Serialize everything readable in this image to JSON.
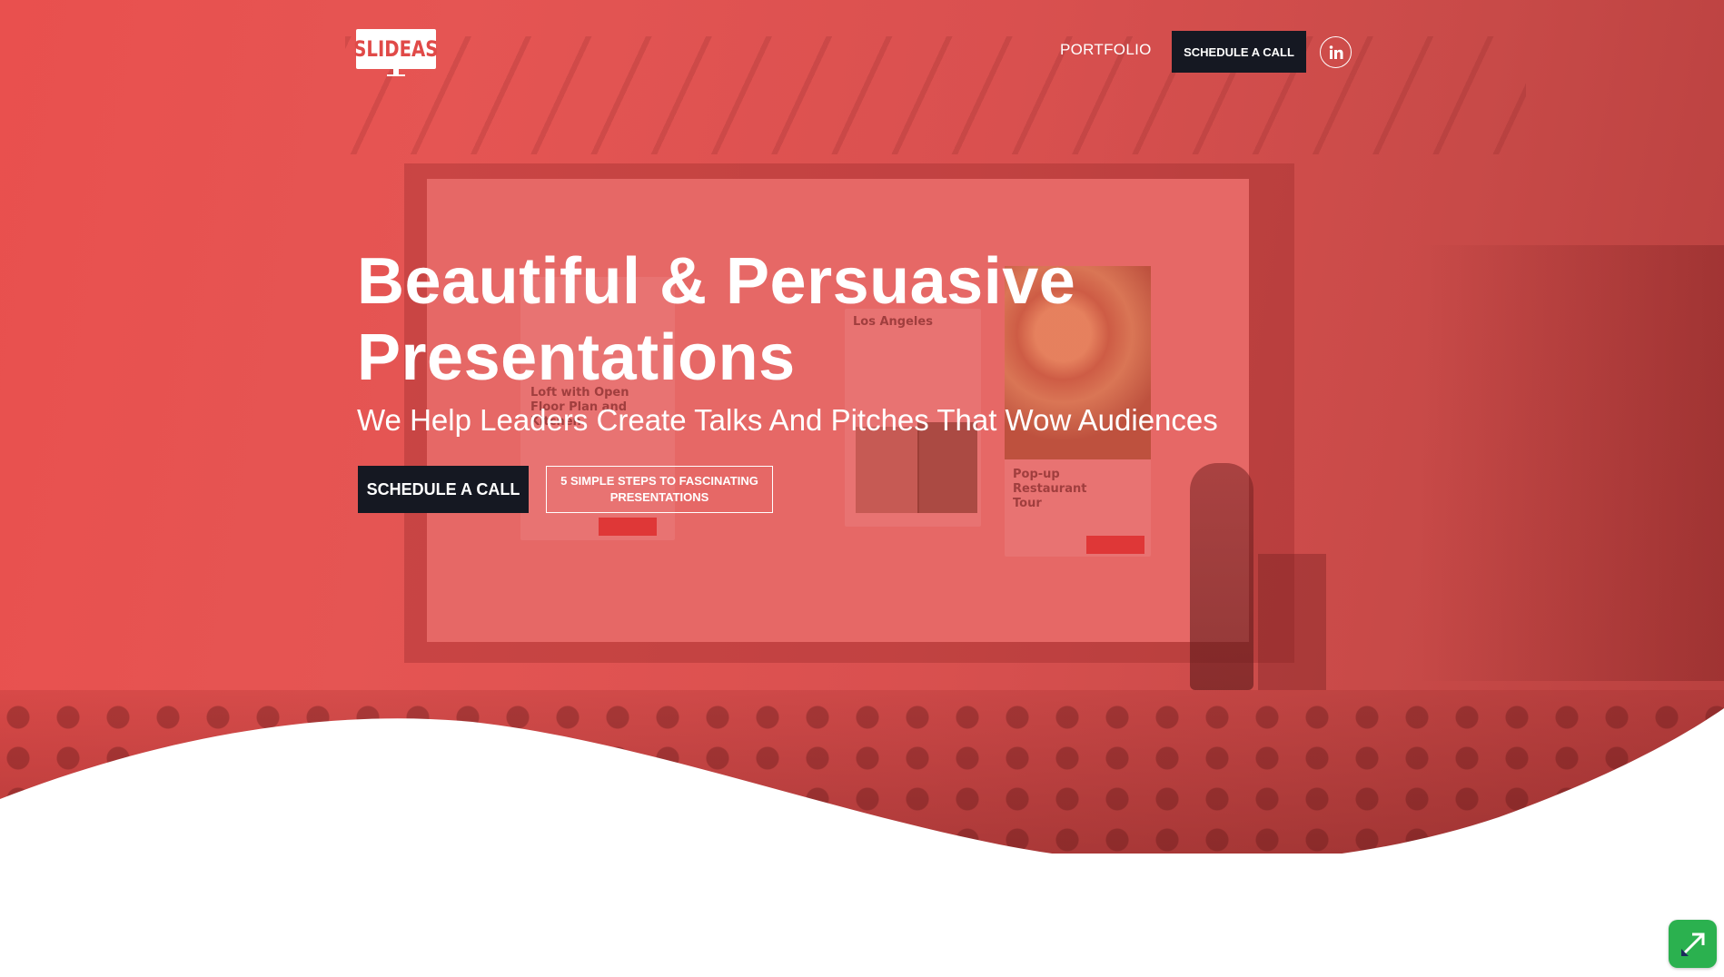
{
  "header": {
    "logo_text": "SLIDEAS",
    "nav_portfolio": "PORTFOLIO",
    "nav_cta": "SCHEDULE A CALL",
    "social_icon": "linkedin-icon"
  },
  "hero": {
    "headline_line1": "Beautiful & Persuasive",
    "headline_line2": "Presentations",
    "subheadline": "We Help Leaders Create Talks And Pitches That Wow Audiences",
    "primary_button": "SCHEDULE A CALL",
    "secondary_button": "5 SIMPLE STEPS TO FASCINATING PRESENTATIONS",
    "background": "stage-presentation-photo"
  },
  "background_screen": {
    "texts": [
      "Los Angeles",
      "Loft with Open Floor Plan and Kitchen",
      "Pop-up Restaurant Tour"
    ]
  },
  "colors": {
    "brand_red": "#e04a48",
    "dark_button": "#151822",
    "white": "#ffffff",
    "widget_green": "#2bb14f"
  },
  "widget": {
    "icon": "app-shortcut-icon"
  }
}
